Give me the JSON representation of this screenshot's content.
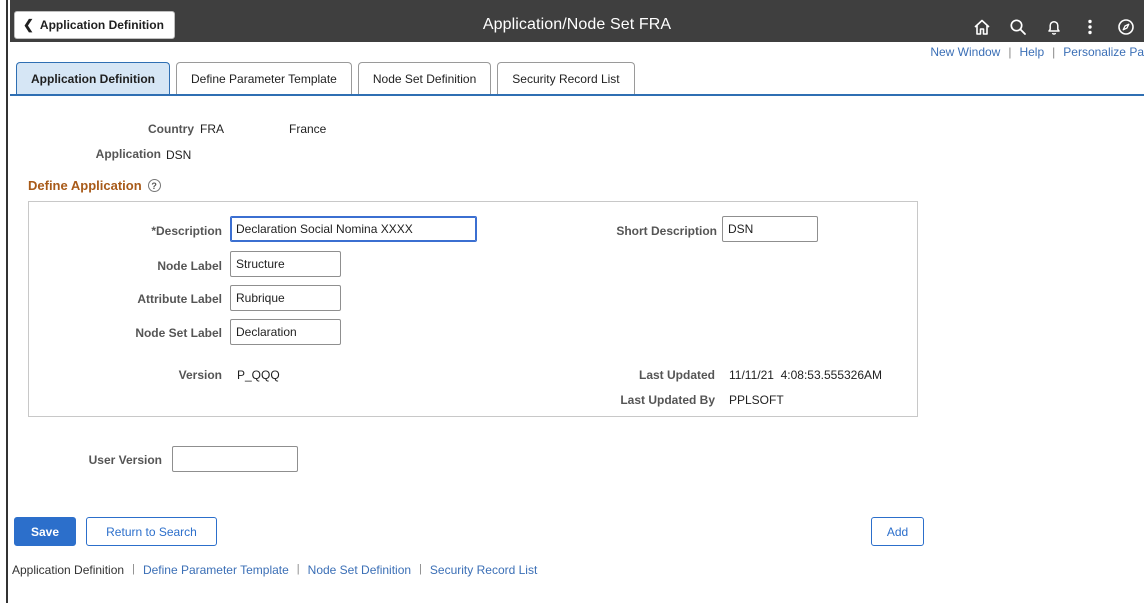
{
  "header": {
    "back_label": "Application Definition",
    "title": "Application/Node Set FRA",
    "icons": [
      "home-icon",
      "search-icon",
      "bell-icon",
      "more-vertical-icon",
      "navbar-icon"
    ]
  },
  "utility": {
    "new_window": "New Window",
    "help": "Help",
    "personalize": "Personalize Pa"
  },
  "tabs": [
    {
      "label": "Application Definition",
      "active": true
    },
    {
      "label": "Define Parameter Template",
      "active": false
    },
    {
      "label": "Node Set Definition",
      "active": false
    },
    {
      "label": "Security Record List",
      "active": false
    }
  ],
  "summary": {
    "country_label": "Country",
    "country_code": "FRA",
    "country_name": "France",
    "application_label": "Application",
    "application_value": "DSN"
  },
  "define_application": {
    "title": "Define Application",
    "description_label": "*Description",
    "description_value": "Declaration Social Nomina XXXX",
    "short_description_label": "Short Description",
    "short_description_value": "DSN",
    "node_label_label": "Node Label",
    "node_label_value": "Structure",
    "attribute_label_label": "Attribute Label",
    "attribute_label_value": "Rubrique",
    "node_set_label_label": "Node Set Label",
    "node_set_label_value": "Declaration",
    "version_label": "Version",
    "version_value": "P_QQQ",
    "last_updated_label": "Last Updated",
    "last_updated_value": "11/11/21  4:08:53.555326AM",
    "last_updated_by_label": "Last Updated By",
    "last_updated_by_value": "PPLSOFT"
  },
  "user_version": {
    "label": "User Version",
    "value": ""
  },
  "buttons": {
    "save": "Save",
    "return_to_search": "Return to Search",
    "add": "Add"
  },
  "footer": {
    "current": "Application Definition",
    "links": [
      "Define Parameter Template",
      "Node Set Definition",
      "Security Record List"
    ],
    "separator": "|"
  },
  "colors": {
    "header_bg": "#3f3f3f",
    "accent": "#2c6fcb",
    "section_title": "#a85a18",
    "active_tab_bg": "#d6e6f5"
  }
}
